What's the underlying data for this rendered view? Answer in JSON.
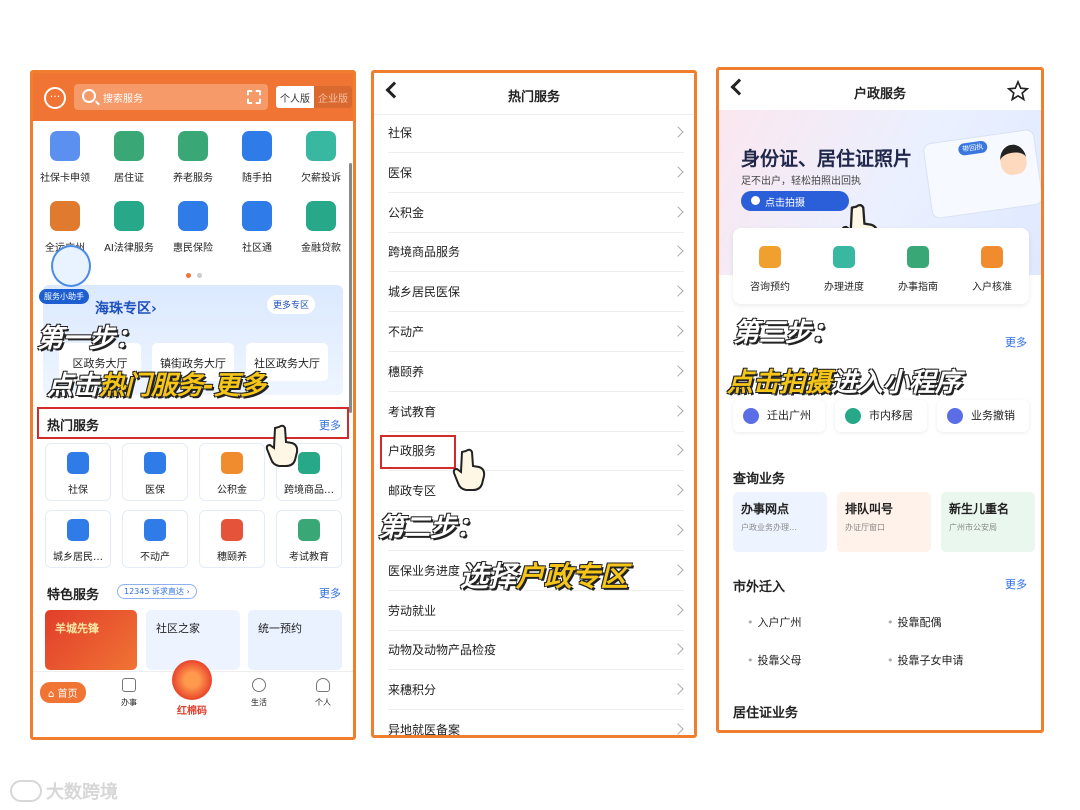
{
  "colors": {
    "accent": "#f07434",
    "highlight_box": "#d12b2b",
    "link": "#2f6fe4",
    "step_text": "#ffffff",
    "step_emphasis": "#f5c518"
  },
  "panel1": {
    "search_placeholder": "搜索服务",
    "version_personal": "个人版",
    "version_business": "企业版",
    "row1": [
      {
        "label": "社保卡申领",
        "icon": "id-card-icon",
        "color": "#5b8ff0"
      },
      {
        "label": "居住证",
        "icon": "residence-permit-icon",
        "color": "#3aa876"
      },
      {
        "label": "养老服务",
        "icon": "elderly-icon",
        "color": "#3aa876"
      },
      {
        "label": "随手拍",
        "icon": "camera-icon",
        "color": "#2f7be8"
      },
      {
        "label": "欠薪投诉",
        "icon": "complaint-icon",
        "color": "#38b8a0"
      }
    ],
    "row2": [
      {
        "label": "全运广州",
        "icon": "games-icon",
        "color": "#e07a2e"
      },
      {
        "label": "AI法律服务",
        "icon": "ai-law-icon",
        "color": "#26a889"
      },
      {
        "label": "惠民保险",
        "icon": "insurance-icon",
        "color": "#2f7be8"
      },
      {
        "label": "社区通",
        "icon": "community-icon",
        "color": "#2f7be8"
      },
      {
        "label": "金融贷款",
        "icon": "loan-icon",
        "color": "#26a889"
      }
    ],
    "helper_badge": "服务小助手",
    "haizhu_title": "海珠专区",
    "haizhu_chevron": "›",
    "haizhu_more": "更多专区",
    "haizhu_buttons": [
      "区政务大厅",
      "镇街政务大厅",
      "社区政务大厅"
    ],
    "hot_title": "热门服务",
    "hot_more": "更多",
    "hot_tiles": [
      {
        "label": "社保",
        "icon": "shield-icon",
        "color": "#2f7be8"
      },
      {
        "label": "医保",
        "icon": "medical-card-icon",
        "color": "#2f7be8"
      },
      {
        "label": "公积金",
        "icon": "house-fund-icon",
        "color": "#f08c2e"
      },
      {
        "label": "跨境商品…",
        "icon": "cross-border-icon",
        "color": "#26a889"
      },
      {
        "label": "城乡居民…",
        "icon": "resident-icon",
        "color": "#2f7be8"
      },
      {
        "label": "不动产",
        "icon": "property-icon",
        "color": "#2f7be8"
      },
      {
        "label": "穗颐养",
        "icon": "care-icon",
        "color": "#e5533a"
      },
      {
        "label": "考试教育",
        "icon": "graduation-icon",
        "color": "#3aa876"
      }
    ],
    "feature_title": "特色服务",
    "feature_badge": "12345 诉求直达 ›",
    "feature_more": "更多",
    "feature_cards": [
      "羊城先锋",
      "社区之家",
      "统一预约"
    ],
    "tabs": {
      "home": "首页",
      "work": "办事",
      "redcode": "红棉码",
      "life": "生活",
      "me": "个人"
    },
    "step_line1": "第一步：",
    "step_line2_a": "点击",
    "step_line2_b": "热门服务-更多"
  },
  "panel2": {
    "title": "热门服务",
    "items": [
      "社保",
      "医保",
      "公积金",
      "跨境商品服务",
      "城乡居民医保",
      "不动产",
      "穗颐养",
      "考试教育",
      "户政服务",
      "邮政专区",
      "…",
      "医保业务进度",
      "劳动就业",
      "动物及动物产品检疫",
      "来穗积分",
      "异地就医备案"
    ],
    "step_line1": "第二步：",
    "step_line2_a": "选择",
    "step_line2_b": "户政专区"
  },
  "panel3": {
    "title": "户政服务",
    "banner_title": "身份证、居住证照片",
    "banner_sub": "足不出户，轻松拍照出回执",
    "banner_btn": "点击拍摄",
    "card_tag": "带回执",
    "quick": [
      {
        "label": "咨询预约",
        "color": "#f0a02e"
      },
      {
        "label": "办理进度",
        "color": "#38b8a0"
      },
      {
        "label": "办事指南",
        "color": "#3aa876"
      },
      {
        "label": "入户核准",
        "color": "#f08c2e"
      }
    ],
    "more": "更多",
    "chips": [
      {
        "label": "迁出广州",
        "color": "#5b6ee6"
      },
      {
        "label": "市内移居",
        "color": "#26a889"
      },
      {
        "label": "业务撤销",
        "color": "#5b6ee6"
      }
    ],
    "query_title": "查询业务",
    "query_cards": [
      {
        "title": "办事网点",
        "sub": "户政业务办理…",
        "bg": "#eef4ff"
      },
      {
        "title": "排队叫号",
        "sub": "办证厅窗口",
        "bg": "#fff2ea"
      },
      {
        "title": "新生儿重名",
        "sub": "广州市公安局",
        "bg": "#eaf7ef"
      }
    ],
    "outside_title": "市外迁入",
    "outside_more": "更多",
    "outside_items": [
      "入户广州",
      "投靠配偶",
      "投靠父母",
      "投靠子女申请"
    ],
    "residence_title": "居住证业务",
    "step_line1": "第三步：",
    "step_line2_a": "点击拍摄",
    "step_line2_b": "进入小程序"
  },
  "watermark": "大数跨境"
}
